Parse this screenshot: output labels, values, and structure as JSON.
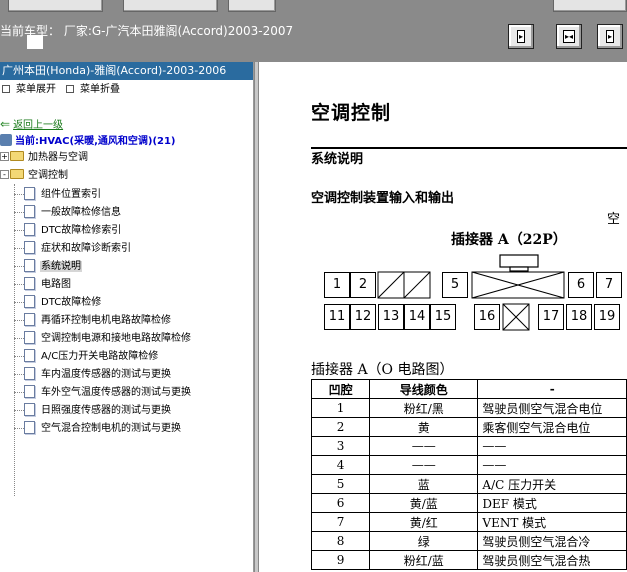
{
  "header": {
    "model_label": "当前车型：  厂家:G-广汽本田雅阁(Accord)2003-2007",
    "nav_buttons": [
      "prev-page",
      "first-last-page",
      "next-page"
    ]
  },
  "sidebar": {
    "title": "广州本田(Honda)-雅阁(Accord)-2003-2006",
    "menu_expand": "菜单展开",
    "menu_collapse": "菜单折叠",
    "back_link": "返回上一级",
    "current": "当前:HVAC(采暖,通风和空调)(21)",
    "folders": [
      {
        "label": "加热器与空调",
        "state": "+"
      },
      {
        "label": "空调控制",
        "state": "-"
      }
    ],
    "items": [
      {
        "label": "组件位置索引"
      },
      {
        "label": "一般故障检修信息"
      },
      {
        "label": "DTC故障检修索引"
      },
      {
        "label": "症状和故障诊断索引"
      },
      {
        "label": "系统说明",
        "selected": true
      },
      {
        "label": "电路图"
      },
      {
        "label": "DTC故障检修"
      },
      {
        "label": "再循环控制电机电路故障检修"
      },
      {
        "label": "空调控制电源和接地电路故障检修"
      },
      {
        "label": "A/C压力开关电路故障检修"
      },
      {
        "label": "车内温度传感器的测试与更换"
      },
      {
        "label": "车外空气温度传感器的测试与更换"
      },
      {
        "label": "日照强度传感器的测试与更换"
      },
      {
        "label": "空气混合控制电机的测试与更换"
      }
    ]
  },
  "content": {
    "title": "空调控制",
    "section1": "系统说明",
    "section2": "空调控制装置输入和输出",
    "side_char": "空",
    "connector_title": "插接器 A（22P）",
    "connector_top_row": [
      "1",
      "2",
      "",
      "",
      "5",
      "",
      "6",
      "7"
    ],
    "connector_bottom_row": [
      "11",
      "12",
      "13",
      "14",
      "15",
      "16",
      "",
      "17",
      "18",
      "19"
    ],
    "table_title": "插接器 A（O 电路图）",
    "table_headers": [
      "凹腔",
      "导线颜色",
      "-"
    ],
    "table_rows": [
      [
        "1",
        "粉红/黑",
        "驾驶员侧空气混合电位"
      ],
      [
        "2",
        "黄",
        "乘客侧空气混合电位"
      ],
      [
        "3",
        "——",
        "——"
      ],
      [
        "4",
        "——",
        "——"
      ],
      [
        "5",
        "蓝",
        "A/C 压力开关"
      ],
      [
        "6",
        "黄/蓝",
        "DEF 模式"
      ],
      [
        "7",
        "黄/红",
        "VENT 模式"
      ],
      [
        "8",
        "绿",
        "驾驶员侧空气混合冷"
      ],
      [
        "9",
        "粉红/蓝",
        "驾驶员侧空气混合热"
      ]
    ]
  }
}
